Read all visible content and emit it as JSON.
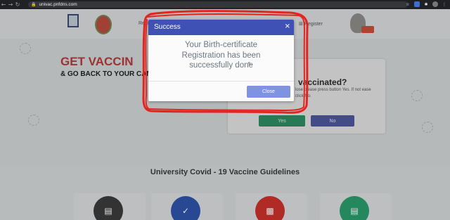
{
  "browser": {
    "url": "univac.pnfdns.com",
    "nav": {
      "back": "←",
      "forward": "→",
      "reload": "↻"
    },
    "lock_icon": "lock-icon",
    "extensions": [
      "star-icon",
      "translate-icon",
      "puzzle-icon",
      "profile-avatar",
      "menu-icon"
    ]
  },
  "header": {
    "nav_left": "Regi",
    "nav_register": "Register",
    "register_icon": "login-icon"
  },
  "hero": {
    "headline": "GET VACCIN",
    "subhead": "& GO BACK TO YOUR CAMPUS"
  },
  "vaccinated_card": {
    "question": "vaccinated?",
    "text": "lose please press button Yes. If not ease click No.",
    "yes_label": "Yes",
    "no_label": "No"
  },
  "guidelines": {
    "title": "University Covid - 19 Vaccine Guidelines",
    "icons": [
      "clipboard-icon",
      "shield-icon",
      "id-card-icon",
      "document-icon"
    ],
    "icon_colors": [
      "#3b3b3b",
      "#2f52a8",
      "#c9302c",
      "#2a9a6b"
    ]
  },
  "modal": {
    "title": "Success",
    "close_icon": "×",
    "message_line1": "Your Birth-certificate",
    "message_line2": "Registration has been",
    "message_line3": "successfully done",
    "close_label": "Close"
  },
  "colors": {
    "modal_header": "#3f51b5",
    "close_button": "#7f93e3",
    "annotation": "#e0261f"
  }
}
